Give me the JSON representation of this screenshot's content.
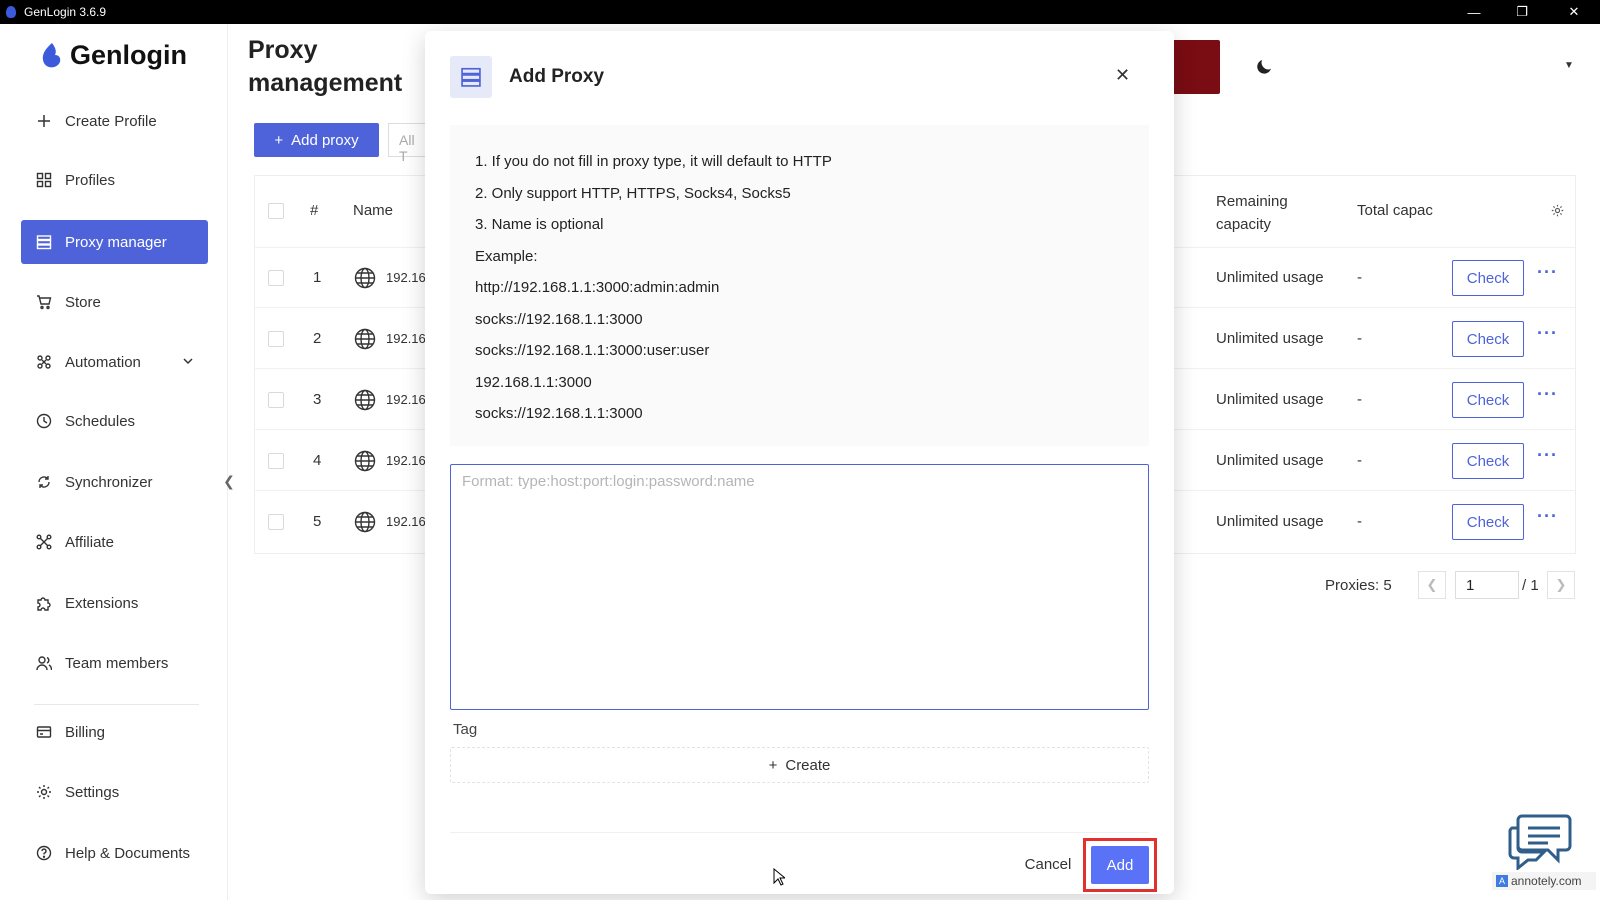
{
  "window": {
    "title": "GenLogin 3.6.9"
  },
  "sidebar": {
    "brand": "Genlogin",
    "items": [
      {
        "label": "Create Profile",
        "icon": "plus-icon"
      },
      {
        "label": "Profiles",
        "icon": "grid-icon"
      },
      {
        "label": "Proxy manager",
        "icon": "server-icon",
        "active": true
      },
      {
        "label": "Store",
        "icon": "cart-icon"
      },
      {
        "label": "Automation",
        "icon": "automation-icon"
      },
      {
        "label": "Schedules",
        "icon": "clock-icon"
      },
      {
        "label": "Synchronizer",
        "icon": "sync-icon"
      },
      {
        "label": "Affiliate",
        "icon": "affiliate-icon"
      },
      {
        "label": "Extensions",
        "icon": "puzzle-icon"
      },
      {
        "label": "Team members",
        "icon": "team-icon"
      },
      {
        "label": "Billing",
        "icon": "card-icon"
      },
      {
        "label": "Settings",
        "icon": "gear-icon"
      },
      {
        "label": "Help & Documents",
        "icon": "help-icon"
      }
    ]
  },
  "page": {
    "title_line1": "Proxy",
    "title_line2": "management",
    "add_proxy_label": "Add proxy",
    "filter_partial": "All T",
    "table": {
      "headers": {
        "index": "#",
        "name": "Name",
        "remaining_line1": "Remaining",
        "remaining_line2": "capacity",
        "total": "Total capac"
      },
      "rows": [
        {
          "index": "1",
          "name": "192.16",
          "remaining": "Unlimited usage",
          "total": "-",
          "action": "Check"
        },
        {
          "index": "2",
          "name": "192.16",
          "remaining": "Unlimited usage",
          "total": "-",
          "action": "Check"
        },
        {
          "index": "3",
          "name": "192.16",
          "remaining": "Unlimited usage",
          "total": "-",
          "action": "Check"
        },
        {
          "index": "4",
          "name": "192.16",
          "remaining": "Unlimited usage",
          "total": "-",
          "action": "Check"
        },
        {
          "index": "5",
          "name": "192.16",
          "remaining": "Unlimited usage",
          "total": "-",
          "action": "Check"
        }
      ]
    },
    "pagination": {
      "count_label": "Proxies: 5",
      "current_page": "1",
      "total_pages": "/ 1"
    }
  },
  "modal": {
    "title": "Add Proxy",
    "instructions": [
      "1. If you do not fill in proxy type, it will default to HTTP",
      "2. Only support HTTP, HTTPS, Socks4, Socks5",
      "3. Name is optional",
      "Example:",
      "http://192.168.1.1:3000:admin:admin",
      "socks://192.168.1.1:3000",
      "socks://192.168.1.1:3000:user:user",
      "192.168.1.1:3000",
      "socks://192.168.1.1:3000"
    ],
    "textarea_placeholder": "Format: type:host:port:login:password:name",
    "textarea_value": "",
    "tag_label": "Tag",
    "create_label": "Create",
    "cancel_label": "Cancel",
    "add_label": "Add"
  },
  "watermark": {
    "text": "annotely.com"
  },
  "colors": {
    "primary": "#4e63d9",
    "add_button": "#5a72f5",
    "highlight": "#e0312e",
    "titlebar": "#000000"
  }
}
